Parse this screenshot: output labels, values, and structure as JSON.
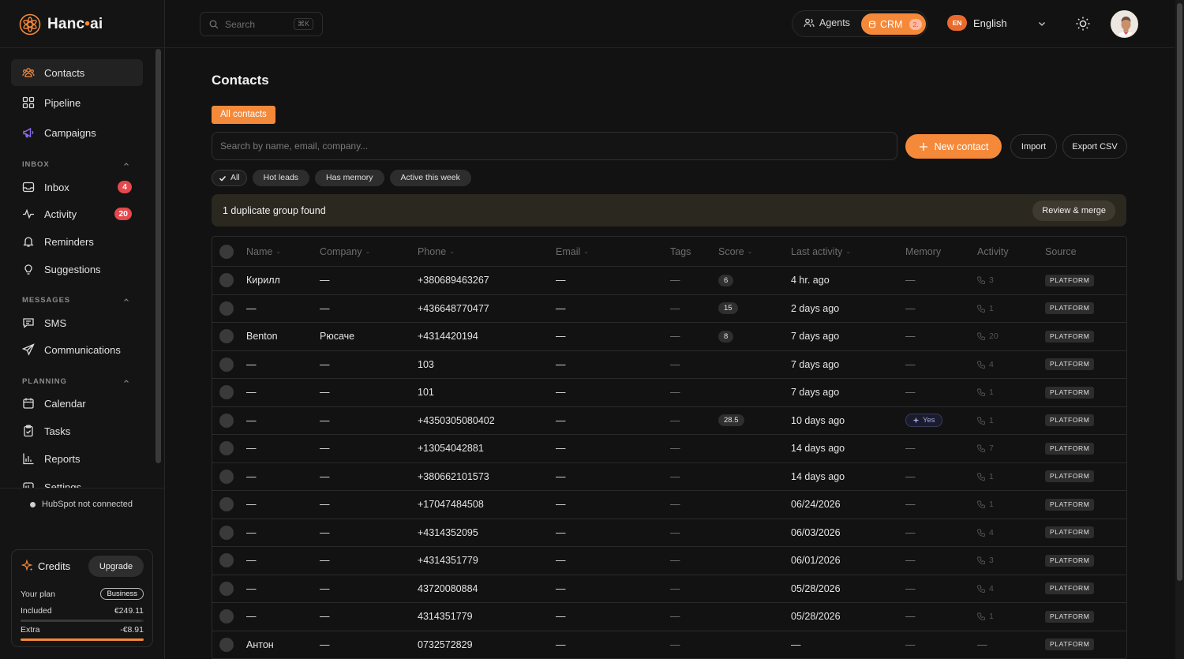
{
  "brand": {
    "name_part1": "Hanc",
    "name_dot": "•",
    "name_part2": "ai"
  },
  "sidebar": {
    "items": [
      {
        "label": "Contacts",
        "icon": "contacts-icon"
      },
      {
        "label": "Pipeline",
        "icon": "pipeline-icon"
      },
      {
        "label": "Campaigns",
        "icon": "megaphone-icon"
      }
    ],
    "inbox_section": "INBOX",
    "inbox_items": [
      {
        "label": "Inbox",
        "badge": "4",
        "icon": "inbox-icon"
      },
      {
        "label": "Activity",
        "badge": "20",
        "icon": "activity-icon"
      },
      {
        "label": "Reminders",
        "icon": "bell-icon"
      },
      {
        "label": "Suggestions",
        "icon": "lightbulb-icon"
      }
    ],
    "messages_section": "MESSAGES",
    "messages_items": [
      {
        "label": "SMS",
        "icon": "sms-icon"
      },
      {
        "label": "Communications",
        "icon": "send-icon"
      }
    ],
    "planning_section": "PLANNING",
    "planning_items": [
      {
        "label": "Calendar",
        "icon": "calendar-icon"
      },
      {
        "label": "Tasks",
        "icon": "clipboard-icon"
      },
      {
        "label": "Reports",
        "icon": "bar-chart-icon"
      },
      {
        "label": "Settings",
        "icon": "settings-icon"
      }
    ],
    "hubspot_status": "HubSpot not connected",
    "credits": {
      "title": "Credits",
      "upgrade_label": "Upgrade",
      "plan_label": "Your plan",
      "plan_value": "Business",
      "included_label": "Included",
      "included_value": "€249.11",
      "extra_label": "Extra",
      "extra_value": "-€8.91",
      "included_fill": 0.98,
      "extra_fill": 1.0
    }
  },
  "header": {
    "search_placeholder": "Search",
    "search_shortcut": "⌘K",
    "agents_label": "Agents",
    "crm_label": "CRM",
    "crm_badge": "2.",
    "language_code": "EN",
    "language_label": "English"
  },
  "main": {
    "title": "Contacts",
    "tab_all": "All contacts",
    "search_placeholder": "Search by name, email, company...",
    "new_contact_label": "New contact",
    "import_label": "Import",
    "export_label": "Export CSV",
    "filters": [
      "All",
      "Hot leads",
      "Has memory",
      "Active this week"
    ],
    "duplicate_text": "1 duplicate group found",
    "review_merge_label": "Review & merge",
    "columns": {
      "name": "Name",
      "company": "Company",
      "phone": "Phone",
      "email": "Email",
      "tags": "Tags",
      "score": "Score",
      "last_activity": "Last activity",
      "memory": "Memory",
      "activity": "Activity",
      "source": "Source"
    },
    "rows": [
      {
        "name": "Кирилл",
        "company": "—",
        "phone": "+380689463267",
        "email": "—",
        "tags": "—",
        "score": "6",
        "last": "4 hr. ago",
        "memory": "—",
        "activity": "3",
        "source": "PLATFORM"
      },
      {
        "name": "—",
        "company": "—",
        "phone": "+436648770477",
        "email": "—",
        "tags": "—",
        "score": "15",
        "last": "2 days ago",
        "memory": "—",
        "activity": "1",
        "source": "PLATFORM"
      },
      {
        "name": "Benton",
        "company": "Рюсаче",
        "phone": "+4314420194",
        "email": "—",
        "tags": "—",
        "score": "8",
        "last": "7 days ago",
        "memory": "—",
        "activity": "20",
        "source": "PLATFORM"
      },
      {
        "name": "—",
        "company": "—",
        "phone": "103",
        "email": "—",
        "tags": "—",
        "score": "",
        "last": "7 days ago",
        "memory": "—",
        "activity": "4",
        "source": "PLATFORM"
      },
      {
        "name": "—",
        "company": "—",
        "phone": "101",
        "email": "—",
        "tags": "—",
        "score": "",
        "last": "7 days ago",
        "memory": "—",
        "activity": "1",
        "source": "PLATFORM"
      },
      {
        "name": "—",
        "company": "—",
        "phone": "+4350305080402",
        "email": "—",
        "tags": "—",
        "score": "28.5",
        "last": "10 days ago",
        "memory": "Yes",
        "activity": "1",
        "source": "PLATFORM"
      },
      {
        "name": "—",
        "company": "—",
        "phone": "+13054042881",
        "email": "—",
        "tags": "—",
        "score": "",
        "last": "14 days ago",
        "memory": "—",
        "activity": "7",
        "source": "PLATFORM"
      },
      {
        "name": "—",
        "company": "—",
        "phone": "+380662101573",
        "email": "—",
        "tags": "—",
        "score": "",
        "last": "14 days ago",
        "memory": "—",
        "activity": "1",
        "source": "PLATFORM"
      },
      {
        "name": "—",
        "company": "—",
        "phone": "+17047484508",
        "email": "—",
        "tags": "—",
        "score": "",
        "last": "06/24/2026",
        "memory": "—",
        "activity": "1",
        "source": "PLATFORM"
      },
      {
        "name": "—",
        "company": "—",
        "phone": "+4314352095",
        "email": "—",
        "tags": "—",
        "score": "",
        "last": "06/03/2026",
        "memory": "—",
        "activity": "4",
        "source": "PLATFORM"
      },
      {
        "name": "—",
        "company": "—",
        "phone": "+4314351779",
        "email": "—",
        "tags": "—",
        "score": "",
        "last": "06/01/2026",
        "memory": "—",
        "activity": "3",
        "source": "PLATFORM"
      },
      {
        "name": "—",
        "company": "—",
        "phone": "43720080884",
        "email": "—",
        "tags": "—",
        "score": "",
        "last": "05/28/2026",
        "memory": "—",
        "activity": "4",
        "source": "PLATFORM"
      },
      {
        "name": "—",
        "company": "—",
        "phone": "4314351779",
        "email": "—",
        "tags": "—",
        "score": "",
        "last": "05/28/2026",
        "memory": "—",
        "activity": "1",
        "source": "PLATFORM"
      },
      {
        "name": "Антон",
        "company": "—",
        "phone": "0732572829",
        "email": "—",
        "tags": "—",
        "score": "",
        "last": "—",
        "memory": "—",
        "activity": "—",
        "source": "PLATFORM"
      }
    ]
  },
  "colors": {
    "accent": "#f5893a",
    "badge": "#e5484d",
    "background": "#121212"
  }
}
